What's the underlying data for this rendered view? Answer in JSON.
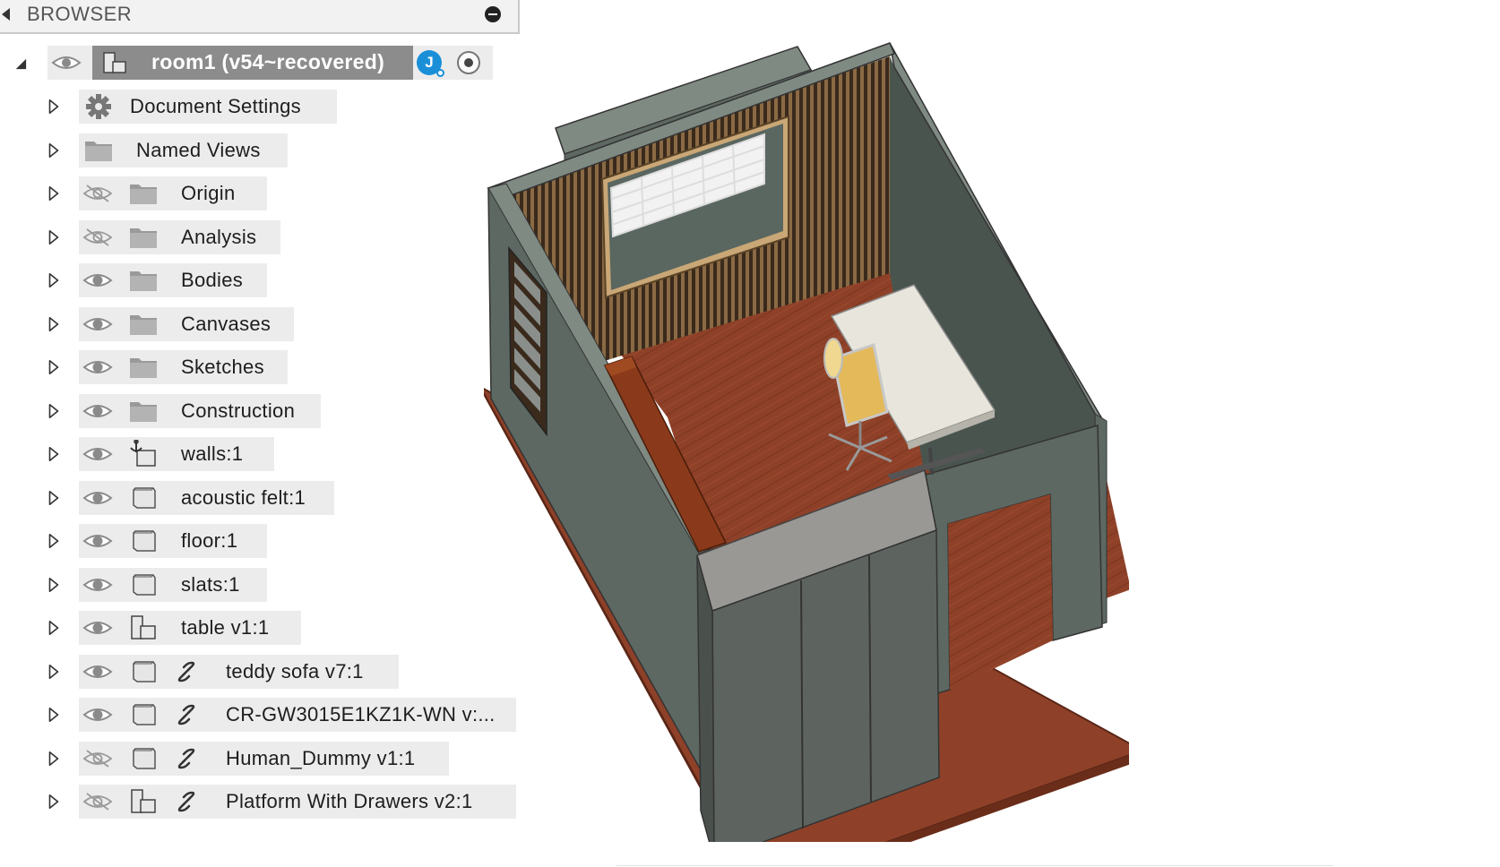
{
  "panel": {
    "title": "BROWSER"
  },
  "root": {
    "label": "room1 (v54~recovered)",
    "avatar_initial": "J"
  },
  "items": [
    {
      "label": "Document Settings",
      "icon": "gear-icon",
      "eye": "none",
      "link": false
    },
    {
      "label": "Named Views",
      "icon": "folder-icon",
      "eye": "none",
      "link": false
    },
    {
      "label": "Origin",
      "icon": "folder-icon",
      "eye": "hidden",
      "link": false
    },
    {
      "label": "Analysis",
      "icon": "folder-icon",
      "eye": "hidden",
      "link": false
    },
    {
      "label": "Bodies",
      "icon": "folder-icon",
      "eye": "visible",
      "link": false
    },
    {
      "label": "Canvases",
      "icon": "folder-icon",
      "eye": "visible",
      "link": false
    },
    {
      "label": "Sketches",
      "icon": "folder-icon",
      "eye": "visible",
      "link": false
    },
    {
      "label": "Construction",
      "icon": "folder-icon",
      "eye": "visible",
      "link": false
    },
    {
      "label": "walls:1",
      "icon": "anchored-component-icon",
      "eye": "visible",
      "link": false
    },
    {
      "label": "acoustic felt:1",
      "icon": "body-icon",
      "eye": "visible",
      "link": false
    },
    {
      "label": "floor:1",
      "icon": "body-icon",
      "eye": "visible",
      "link": false
    },
    {
      "label": "slats:1",
      "icon": "body-icon",
      "eye": "visible",
      "link": false
    },
    {
      "label": "table v1:1",
      "icon": "component-icon",
      "eye": "visible",
      "link": false
    },
    {
      "label": "teddy sofa v7:1",
      "icon": "body-icon",
      "eye": "visible",
      "link": true
    },
    {
      "label": "CR-GW3015E1KZ1K-WN v:...",
      "icon": "body-icon",
      "eye": "visible",
      "link": true
    },
    {
      "label": "Human_Dummy v1:1",
      "icon": "body-icon",
      "eye": "hidden",
      "link": true
    },
    {
      "label": "Platform With Drawers v2:1",
      "icon": "component-icon",
      "eye": "hidden",
      "link": true
    }
  ],
  "colors": {
    "wall": "#5d6862",
    "wall_top": "#7f8a83",
    "floor": "#8a3f26",
    "slats": "#6b4a2a",
    "accent": "#1a8fd8"
  }
}
